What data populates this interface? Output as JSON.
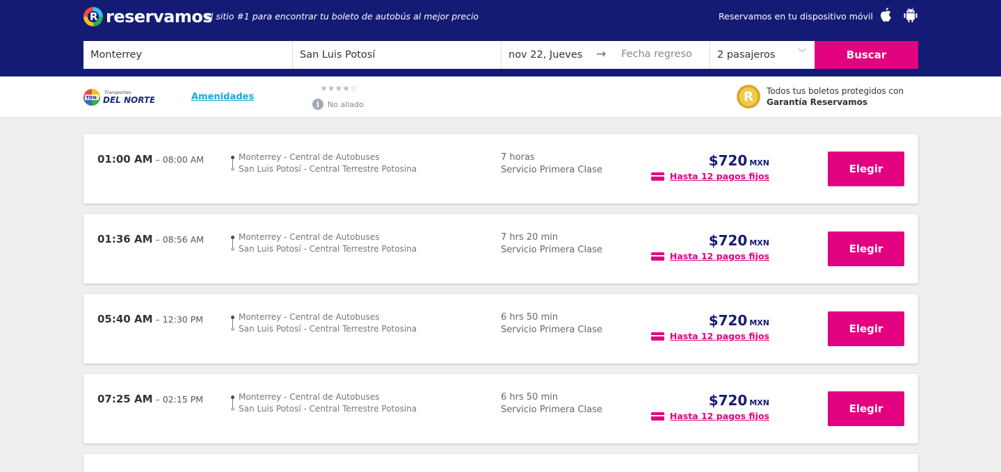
{
  "header": {
    "logo_text": "reservamos",
    "tagline": "El sitio #1 para encontrar tu boleto de autobús al mejor precio",
    "mobile_text": "Reservamos en tu dispositivo móvil"
  },
  "search": {
    "origin": "Monterrey",
    "destination": "San Luis Potosí",
    "departure_date": "nov 22, Jueves",
    "return_placeholder": "Fecha regreso",
    "passengers": "2 pasajeros",
    "button": "Buscar"
  },
  "carrier": {
    "name": "Transportes Del Norte",
    "amenities_link": "Amenidades",
    "stars": "★★★★☆",
    "affiliation": "No aliado",
    "guarantee_line1": "Todos tus boletos protegidos con",
    "guarantee_line2": "Garantía Reservamos"
  },
  "trips": [
    {
      "departure": "01:00 AM",
      "arrival": "08:00 AM",
      "origin_terminal": "Monterrey - Central de Autobuses",
      "destination_terminal": "San Luis Potosí - Central Terrestre Potosina",
      "duration": "7 horas",
      "service": "Servicio Primera Clase",
      "price": "$720",
      "currency": "MXN",
      "installments": "Hasta 12 pagos fijos",
      "button": "Elegir"
    },
    {
      "departure": "01:36 AM",
      "arrival": "08:56 AM",
      "origin_terminal": "Monterrey - Central de Autobuses",
      "destination_terminal": "San Luis Potosí - Central Terrestre Potosina",
      "duration": "7 hrs 20 min",
      "service": "Servicio Primera Clase",
      "price": "$720",
      "currency": "MXN",
      "installments": "Hasta 12 pagos fijos",
      "button": "Elegir"
    },
    {
      "departure": "05:40 AM",
      "arrival": "12:30 PM",
      "origin_terminal": "Monterrey - Central de Autobuses",
      "destination_terminal": "San Luis Potosí - Central Terrestre Potosina",
      "duration": "6 hrs 50 min",
      "service": "Servicio Primera Clase",
      "price": "$720",
      "currency": "MXN",
      "installments": "Hasta 12 pagos fijos",
      "button": "Elegir"
    },
    {
      "departure": "07:25 AM",
      "arrival": "02:15 PM",
      "origin_terminal": "Monterrey - Central de Autobuses",
      "destination_terminal": "San Luis Potosí - Central Terrestre Potosina",
      "duration": "6 hrs 50 min",
      "service": "Servicio Primera Clase",
      "price": "$720",
      "currency": "MXN",
      "installments": "Hasta 12 pagos fijos",
      "button": "Elegir"
    }
  ],
  "colors": {
    "header_bg": "#141b75",
    "accent": "#e2027f",
    "link": "#1aa6d9",
    "page_bg": "#efefef"
  }
}
